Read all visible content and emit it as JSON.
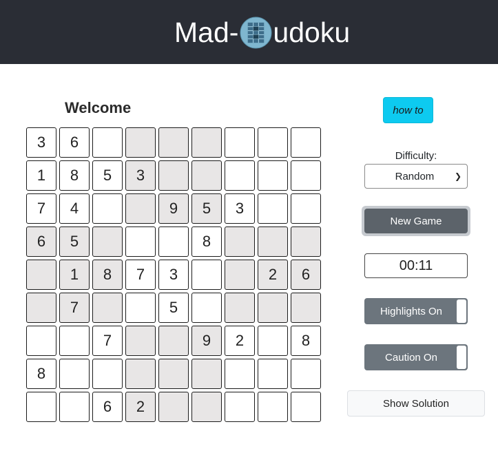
{
  "header": {
    "title_left": "Mad-",
    "title_right": "udoku",
    "logo_icon": "sudoku-grid-logo-icon"
  },
  "welcome": "Welcome",
  "board": {
    "rows": [
      [
        "3",
        "6",
        "",
        "",
        "",
        "",
        "",
        "",
        ""
      ],
      [
        "1",
        "8",
        "5",
        "3",
        "",
        "",
        "",
        "",
        ""
      ],
      [
        "7",
        "4",
        "",
        "",
        "9",
        "5",
        "3",
        "",
        ""
      ],
      [
        "6",
        "5",
        "",
        "",
        "",
        "8",
        "",
        "",
        ""
      ],
      [
        "",
        "1",
        "8",
        "7",
        "3",
        "",
        "",
        "2",
        "6"
      ],
      [
        "",
        "7",
        "",
        "",
        "5",
        "",
        "",
        "",
        ""
      ],
      [
        "",
        "",
        "7",
        "",
        "",
        "9",
        "2",
        "",
        "8"
      ],
      [
        "8",
        "",
        "",
        "",
        "",
        "",
        "",
        "",
        ""
      ],
      [
        "",
        "",
        "6",
        "2",
        "",
        "",
        "",
        "",
        ""
      ]
    ],
    "shaded": [
      [
        0,
        0,
        0,
        1,
        1,
        1,
        0,
        0,
        0
      ],
      [
        0,
        0,
        0,
        1,
        1,
        1,
        0,
        0,
        0
      ],
      [
        0,
        0,
        0,
        1,
        1,
        1,
        0,
        0,
        0
      ],
      [
        1,
        1,
        1,
        0,
        0,
        0,
        1,
        1,
        1
      ],
      [
        1,
        1,
        1,
        0,
        0,
        0,
        1,
        1,
        1
      ],
      [
        1,
        1,
        1,
        0,
        0,
        0,
        1,
        1,
        1
      ],
      [
        0,
        0,
        0,
        1,
        1,
        1,
        0,
        0,
        0
      ],
      [
        0,
        0,
        0,
        1,
        1,
        1,
        0,
        0,
        0
      ],
      [
        0,
        0,
        0,
        1,
        1,
        1,
        0,
        0,
        0
      ]
    ]
  },
  "controls": {
    "how_to": "how to",
    "difficulty_label": "Difficulty:",
    "difficulty_value": "Random",
    "new_game": "New Game",
    "timer": "00:11",
    "highlights": "Highlights On",
    "caution": "Caution On",
    "show_solution": "Show Solution"
  },
  "colors": {
    "header_bg": "#2a2d35",
    "accent_cyan": "#0dcaf0",
    "shaded_cell": "#e8e6e6",
    "button_gray": "#6c757d"
  }
}
